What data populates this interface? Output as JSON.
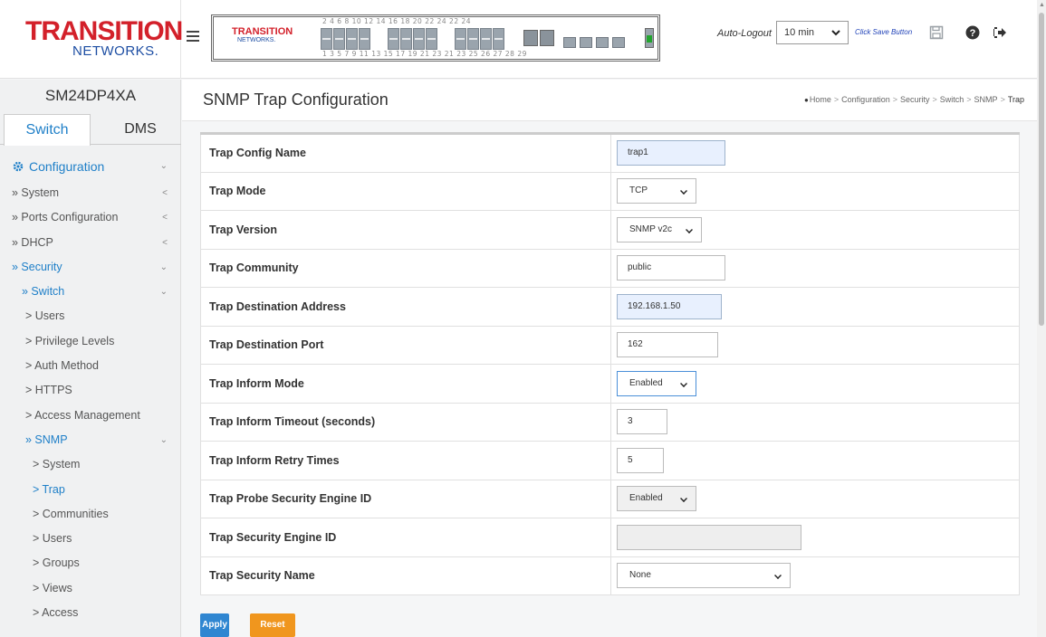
{
  "header": {
    "logo_top": "TRANSITION",
    "logo_bottom": "NETWORKS.",
    "panel_logo_top": "TRANSITION",
    "panel_logo_bottom": "NETWORKS.",
    "port_numbers_top": "2   4   6   8   10  12  14  16  18  20  22  24  22  24",
    "port_numbers_bottom": "1   3   5   7   9   11  13  15  17  19  21  23  21  23   25  26  27  28   29",
    "autologout_label": "Auto-Logout",
    "autologout_value": "10 min",
    "save_link": "Click Save Button",
    "icons": [
      "save-icon",
      "help-icon",
      "logout-icon"
    ]
  },
  "sidebar": {
    "device_name": "SM24DP4XA",
    "tabs": [
      "Switch",
      "DMS"
    ],
    "nav": [
      {
        "label": "Configuration",
        "level": "top",
        "active": true,
        "chevron": "⌄"
      },
      {
        "label": "» System",
        "level": "lv1",
        "active": false,
        "chevron": "<"
      },
      {
        "label": "» Ports Configuration",
        "level": "lv1",
        "active": false,
        "chevron": "<"
      },
      {
        "label": "» DHCP",
        "level": "lv1",
        "active": false,
        "chevron": "<"
      },
      {
        "label": "» Security",
        "level": "lv1",
        "active": true,
        "chevron": "⌄"
      },
      {
        "label": "» Switch",
        "level": "lv2",
        "active": true,
        "chevron": "⌄"
      },
      {
        "label": "> Users",
        "level": "lv3",
        "active": false,
        "chevron": ""
      },
      {
        "label": "> Privilege Levels",
        "level": "lv3",
        "active": false,
        "chevron": ""
      },
      {
        "label": "> Auth Method",
        "level": "lv3",
        "active": false,
        "chevron": ""
      },
      {
        "label": "> HTTPS",
        "level": "lv3",
        "active": false,
        "chevron": ""
      },
      {
        "label": "> Access Management",
        "level": "lv3",
        "active": false,
        "chevron": ""
      },
      {
        "label": "» SNMP",
        "level": "lv3",
        "active": true,
        "chevron": "⌄"
      },
      {
        "label": "> System",
        "level": "lv4",
        "active": false,
        "chevron": ""
      },
      {
        "label": "> Trap",
        "level": "lv4",
        "active": true,
        "chevron": ""
      },
      {
        "label": "> Communities",
        "level": "lv4",
        "active": false,
        "chevron": ""
      },
      {
        "label": "> Users",
        "level": "lv4",
        "active": false,
        "chevron": ""
      },
      {
        "label": "> Groups",
        "level": "lv4",
        "active": false,
        "chevron": ""
      },
      {
        "label": "> Views",
        "level": "lv4",
        "active": false,
        "chevron": ""
      },
      {
        "label": "> Access",
        "level": "lv4",
        "active": false,
        "chevron": ""
      }
    ]
  },
  "main": {
    "title": "SNMP Trap Configuration",
    "breadcrumb": [
      "Home",
      "Configuration",
      "Security",
      "Switch",
      "SNMP",
      "Trap"
    ],
    "rows": [
      {
        "label": "Trap Config Name",
        "type": "input",
        "value": "trap1",
        "style": "hl",
        "w": 120
      },
      {
        "label": "Trap Mode",
        "type": "select",
        "value": "TCP",
        "style": "",
        "w": 88
      },
      {
        "label": "Trap Version",
        "type": "select",
        "value": "SNMP v2c",
        "style": "",
        "w": 94
      },
      {
        "label": "Trap Community",
        "type": "input",
        "value": "public",
        "style": "",
        "w": 120
      },
      {
        "label": "Trap Destination Address",
        "type": "input",
        "value": "192.168.1.50",
        "style": "hl",
        "w": 116
      },
      {
        "label": "Trap Destination Port",
        "type": "input",
        "value": "162",
        "style": "",
        "w": 112
      },
      {
        "label": "Trap Inform Mode",
        "type": "select",
        "value": "Enabled",
        "style": "focus",
        "w": 88
      },
      {
        "label": "Trap Inform Timeout (seconds)",
        "type": "input",
        "value": "3",
        "style": "",
        "w": 56
      },
      {
        "label": "Trap Inform Retry Times",
        "type": "input",
        "value": "5",
        "style": "",
        "w": 52
      },
      {
        "label": "Trap Probe Security Engine ID",
        "type": "select",
        "value": "Enabled",
        "style": "grey",
        "w": 88
      },
      {
        "label": "Trap Security Engine ID",
        "type": "input",
        "value": "",
        "style": "dis",
        "w": 204
      },
      {
        "label": "Trap Security Name",
        "type": "select",
        "value": "None",
        "style": "",
        "w": 192
      }
    ],
    "apply_label": "Apply",
    "reset_label": "Reset"
  }
}
